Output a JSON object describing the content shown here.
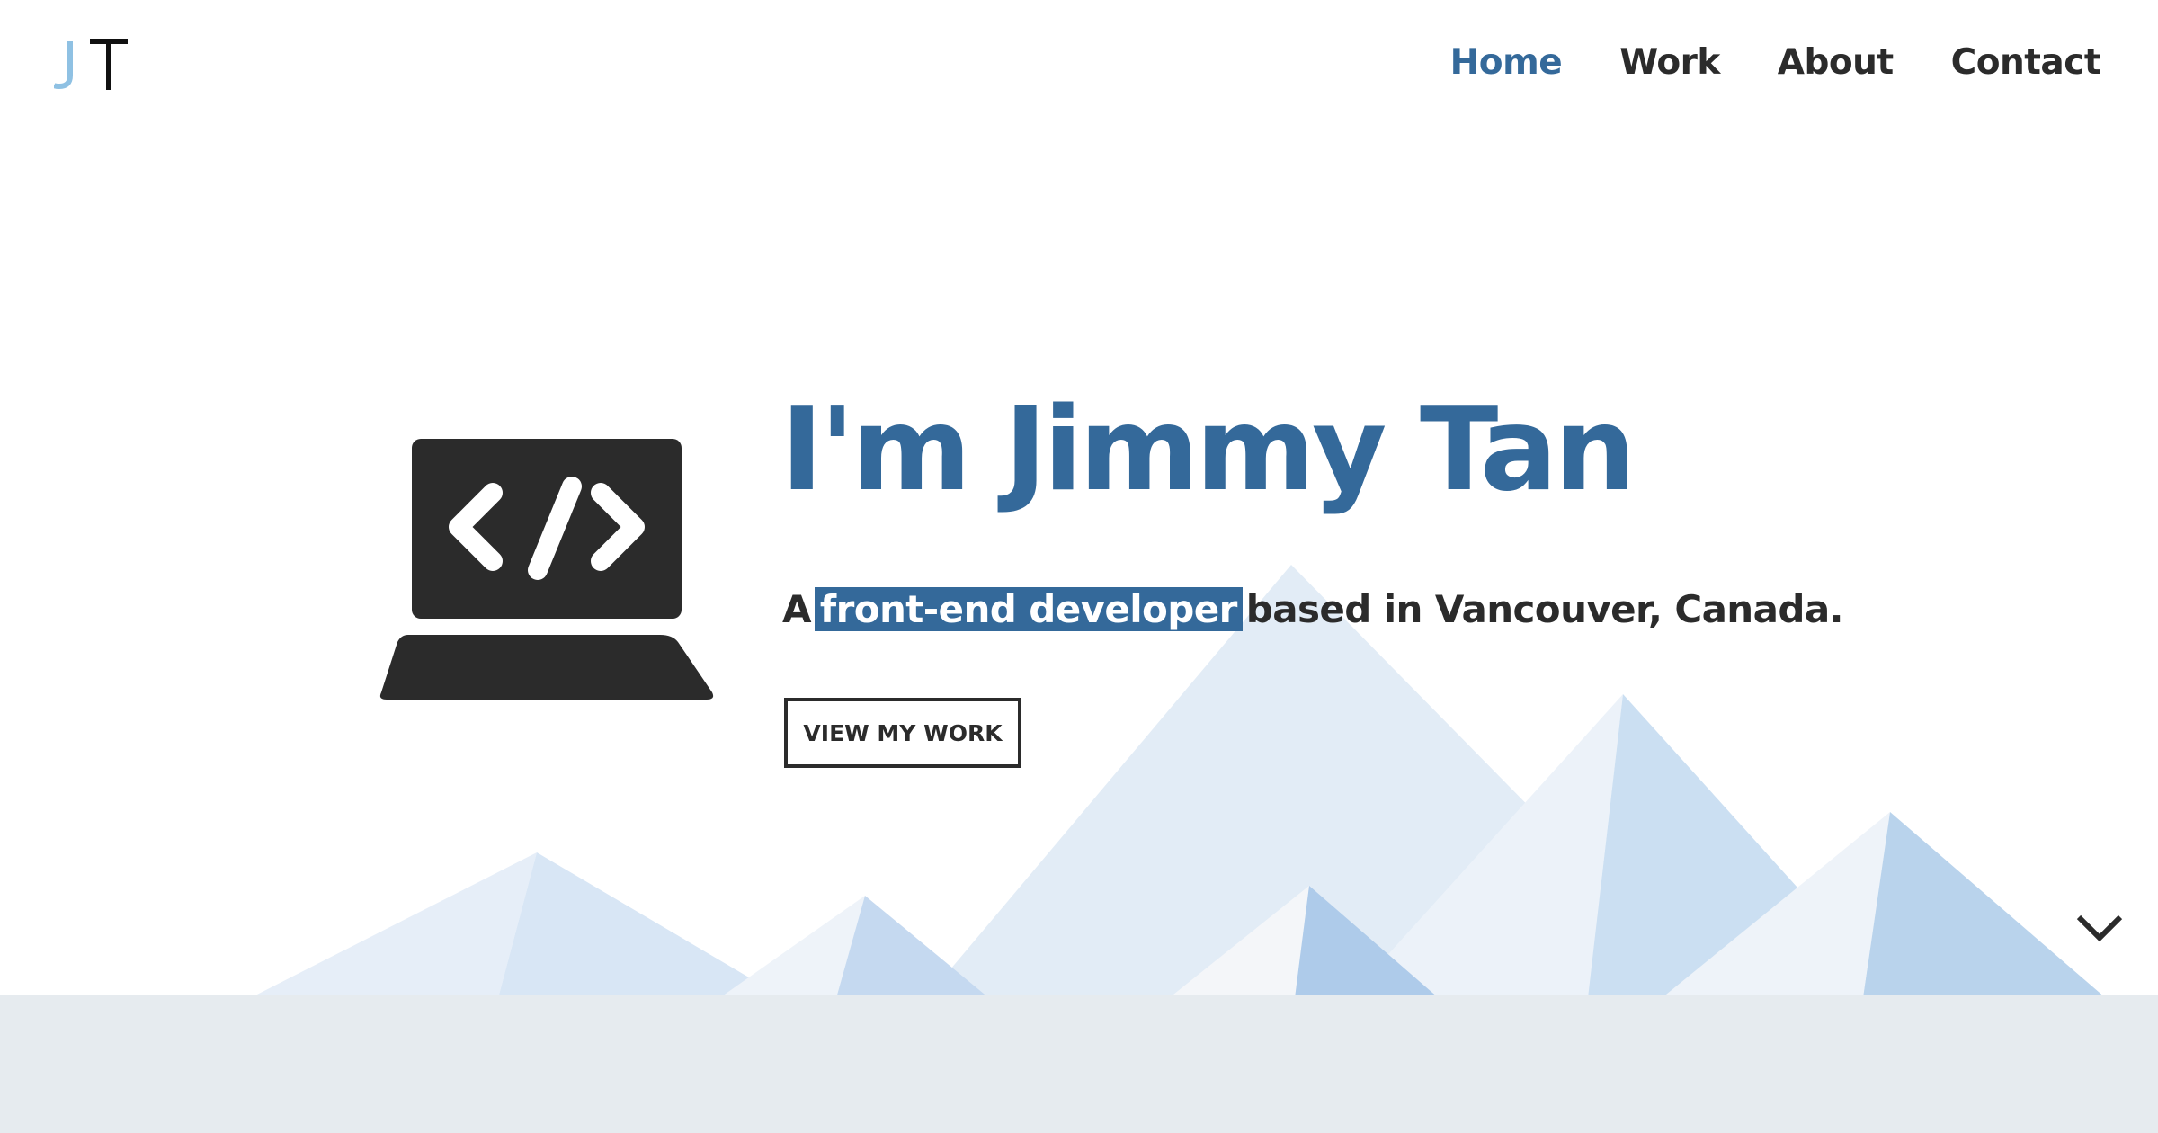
{
  "brand": {
    "logo_letters": "JT",
    "logo_color_j": "#8fc1e3",
    "logo_color_t": "#111111"
  },
  "nav": {
    "items": [
      {
        "label": "Home",
        "active": true
      },
      {
        "label": "Work",
        "active": false
      },
      {
        "label": "About",
        "active": false
      },
      {
        "label": "Contact",
        "active": false
      }
    ]
  },
  "hero": {
    "title": "I'm Jimmy Tan",
    "subtitle_prefix": "A",
    "subtitle_highlight": "front-end developer",
    "subtitle_suffix": "based in Vancouver, Canada.",
    "cta_label": "VIEW MY WORK",
    "illustration_icon": "laptop-code-icon",
    "scroll_icon": "chevron-down-icon"
  },
  "colors": {
    "accent": "#34699a",
    "text": "#2b2b2b",
    "ground": "#e6ebef"
  }
}
